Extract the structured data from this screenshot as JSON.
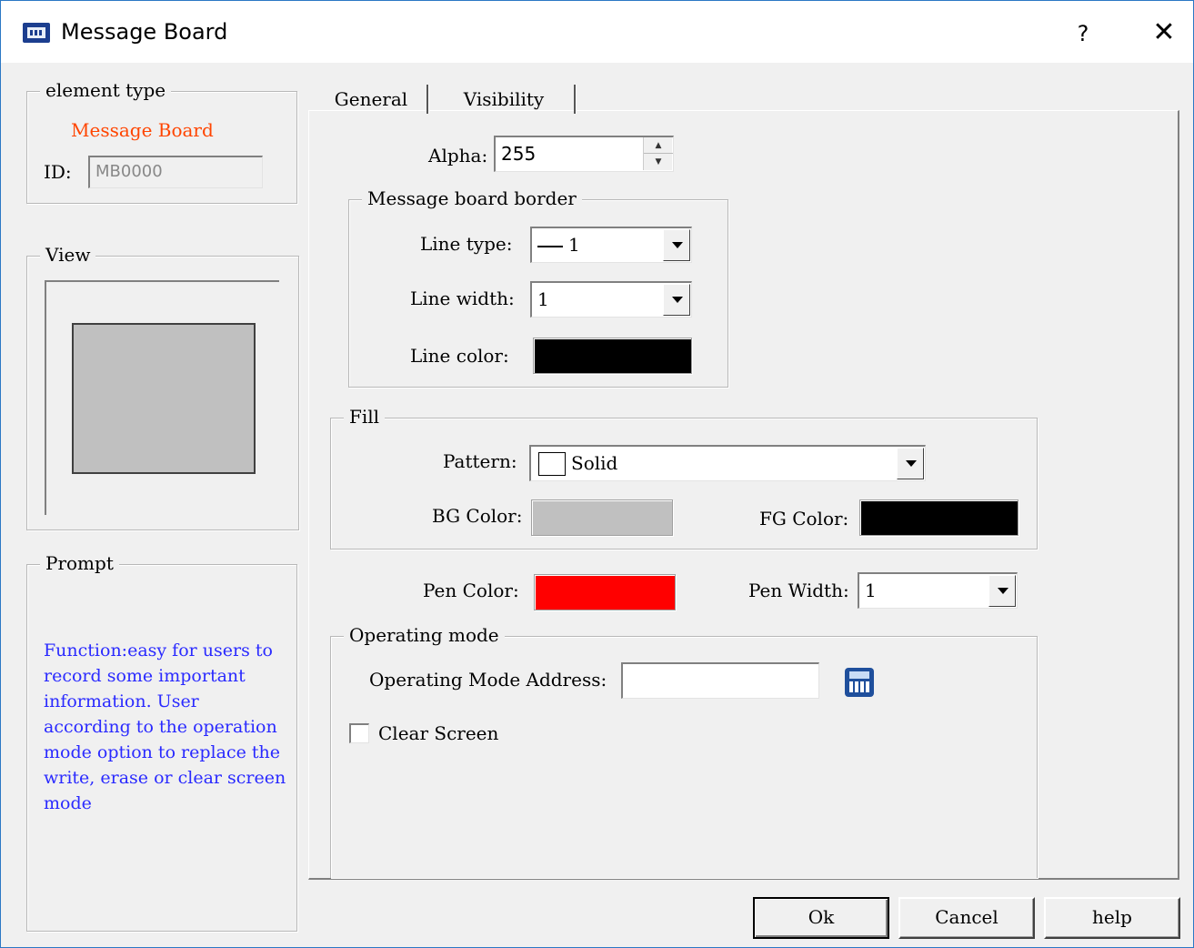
{
  "window": {
    "title": "Message Board",
    "help_glyph": "?",
    "close_glyph": "✕"
  },
  "left": {
    "element_type": {
      "legend": "element type",
      "value": "Message Board",
      "value_color": "#ff4500",
      "id_label": "ID:",
      "id_value": "MB0000"
    },
    "view": {
      "legend": "View",
      "preview_fill": "#c0c0c0"
    },
    "prompt": {
      "legend": "Prompt",
      "text": "Function:easy for users to record some important information. User according to the operation mode option to replace the write, erase or clear screen mode",
      "text_color": "#2a2aff"
    }
  },
  "tabs": [
    {
      "label": "General",
      "selected": true
    },
    {
      "label": "Visibility",
      "selected": false
    }
  ],
  "general": {
    "alpha": {
      "label": "Alpha:",
      "value": "255"
    },
    "border": {
      "legend": "Message board border",
      "line_type_label": "Line type:",
      "line_type_value": "1",
      "line_width_label": "Line width:",
      "line_width_value": "1",
      "line_color_label": "Line color:",
      "line_color": "#000000"
    },
    "fill": {
      "legend": "Fill",
      "pattern_label": "Pattern:",
      "pattern_value": "Solid",
      "bg_color_label": "BG Color:",
      "bg_color": "#c0c0c0",
      "fg_color_label": "FG Color:",
      "fg_color": "#000000"
    },
    "pen": {
      "pen_color_label": "Pen Color:",
      "pen_color": "#ff0000",
      "pen_width_label": "Pen Width:",
      "pen_width_value": "1"
    },
    "operating_mode": {
      "legend": "Operating mode",
      "address_label": "Operating Mode Address:",
      "address_value": "",
      "calculator_icon": "calculator-icon",
      "clear_screen_label": "Clear Screen",
      "clear_screen_checked": false
    }
  },
  "buttons": {
    "ok": "Ok",
    "cancel": "Cancel",
    "help": "help"
  }
}
